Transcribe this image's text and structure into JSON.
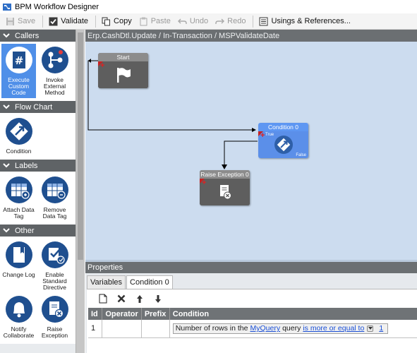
{
  "window": {
    "title": "BPM Workflow Designer"
  },
  "toolbar": {
    "save": "Save",
    "validate": "Validate",
    "copy": "Copy",
    "paste": "Paste",
    "undo": "Undo",
    "redo": "Redo",
    "usings": "Usings & References..."
  },
  "palette": {
    "callers": {
      "header": "Callers",
      "items": [
        {
          "label": "Execute Custom Code",
          "icon": "hash-icon",
          "selected": true
        },
        {
          "label": "Invoke External Method",
          "icon": "network-icon",
          "selected": false
        }
      ]
    },
    "flowchart": {
      "header": "Flow Chart",
      "items": [
        {
          "label": "Condition",
          "icon": "condition-icon"
        }
      ]
    },
    "labels": {
      "header": "Labels",
      "items": [
        {
          "label": "Attach Data Tag",
          "icon": "attach-tag-icon"
        },
        {
          "label": "Remove Data Tag",
          "icon": "remove-tag-icon"
        }
      ]
    },
    "other": {
      "header": "Other",
      "items": [
        {
          "label": "Change Log",
          "icon": "book-icon"
        },
        {
          "label": "Enable Standard Directive",
          "icon": "directive-icon"
        },
        {
          "label": "Notify Collaborate",
          "icon": "bell-icon"
        },
        {
          "label": "Raise Exception",
          "icon": "exception-icon"
        }
      ]
    }
  },
  "breadcrumb": "Erp.CashDtl.Update / In-Transaction / MSPValidateDate",
  "canvas": {
    "nodes": {
      "start": {
        "title": "Start"
      },
      "condition": {
        "title": "Condition 0",
        "true_label": "True",
        "false_label": "False"
      },
      "raise": {
        "title": "Raise Exception 0"
      }
    }
  },
  "properties": {
    "header": "Properties",
    "tabs": [
      "Variables",
      "Condition 0"
    ],
    "active_tab": "Condition 0",
    "columns": [
      "Id",
      "Operator",
      "Prefix",
      "Condition"
    ],
    "rows": [
      {
        "id": "1",
        "operator": "",
        "prefix": "",
        "condition": {
          "text1": "Number of rows in the",
          "link1": "MyQuery",
          "text2": "query",
          "link2": "is more or equal to",
          "link3": "1"
        }
      }
    ]
  },
  "colors": {
    "accent": "#4f8fe8",
    "canvas": "#ccdcef",
    "section_header": "#5f6366",
    "node_gray": "#5e5e5e",
    "node_blue": "#5b8fe9"
  }
}
